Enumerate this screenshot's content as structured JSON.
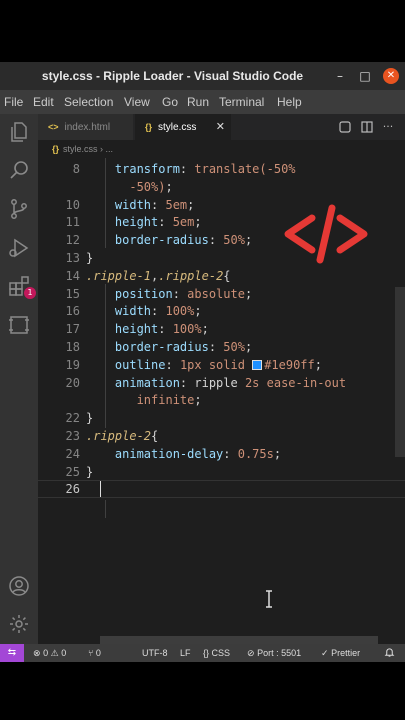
{
  "window": {
    "title": "style.css - Ripple Loader - Visual Studio Code",
    "min_glyph": "–",
    "max_glyph": "□",
    "close_glyph": "✕"
  },
  "menu": [
    "File",
    "Edit",
    "Selection",
    "View",
    "Go",
    "Run",
    "Terminal",
    "Help"
  ],
  "tabs": {
    "items": [
      {
        "icon": "<>",
        "label": "index.html"
      },
      {
        "icon": "{}",
        "label": "style.css",
        "close": "✕"
      }
    ],
    "more_glyph": "···"
  },
  "breadcrumb": {
    "icon": "{}",
    "file": "style.css",
    "sep": "› ..."
  },
  "activity": {
    "extensions_badge": "1"
  },
  "editor": {
    "lines": [
      {
        "n": "8",
        "parts": [
          [
            "p",
            "    transform"
          ],
          [
            "u",
            ": "
          ],
          [
            "v",
            "translate(-50%"
          ]
        ]
      },
      {
        "n": "",
        "parts": [
          [
            "v",
            "      -50%)"
          ],
          [
            "u",
            ";"
          ]
        ]
      },
      {
        "n": "10",
        "parts": [
          [
            "p",
            "    width"
          ],
          [
            "u",
            ": "
          ],
          [
            "v",
            "5em"
          ],
          [
            "u",
            ";"
          ]
        ]
      },
      {
        "n": "11",
        "parts": [
          [
            "p",
            "    height"
          ],
          [
            "u",
            ": "
          ],
          [
            "v",
            "5em"
          ],
          [
            "u",
            ";"
          ]
        ]
      },
      {
        "n": "12",
        "parts": [
          [
            "p",
            "    border-radius"
          ],
          [
            "u",
            ": "
          ],
          [
            "v",
            "50%"
          ],
          [
            "u",
            ";"
          ]
        ]
      },
      {
        "n": "13",
        "parts": [
          [
            "u",
            "}"
          ]
        ]
      },
      {
        "n": "14",
        "parts": [
          [
            "s",
            ".ripple-1"
          ],
          [
            "u",
            ","
          ],
          [
            "s",
            ".ripple-2"
          ],
          [
            "u",
            "{"
          ]
        ]
      },
      {
        "n": "15",
        "parts": [
          [
            "p",
            "    position"
          ],
          [
            "u",
            ": "
          ],
          [
            "v",
            "absolute"
          ],
          [
            "u",
            ";"
          ]
        ]
      },
      {
        "n": "16",
        "parts": [
          [
            "p",
            "    width"
          ],
          [
            "u",
            ": "
          ],
          [
            "v",
            "100%"
          ],
          [
            "u",
            ";"
          ]
        ]
      },
      {
        "n": "17",
        "parts": [
          [
            "p",
            "    height"
          ],
          [
            "u",
            ": "
          ],
          [
            "v",
            "100%"
          ],
          [
            "u",
            ";"
          ]
        ]
      },
      {
        "n": "18",
        "parts": [
          [
            "p",
            "    border-radius"
          ],
          [
            "u",
            ": "
          ],
          [
            "v",
            "50%"
          ],
          [
            "u",
            ";"
          ]
        ]
      },
      {
        "n": "19",
        "parts": [
          [
            "p",
            "    outline"
          ],
          [
            "u",
            ": "
          ],
          [
            "v",
            "1px solid "
          ],
          [
            "c",
            ""
          ],
          [
            "v",
            "#1e90ff"
          ],
          [
            "u",
            ";"
          ]
        ]
      },
      {
        "n": "20",
        "parts": [
          [
            "p",
            "    animation"
          ],
          [
            "u",
            ": "
          ],
          [
            "u",
            "ripple "
          ],
          [
            "v",
            "2s ease-in-out"
          ]
        ]
      },
      {
        "n": "",
        "parts": [
          [
            "v",
            "       infinite"
          ],
          [
            "u",
            ";"
          ]
        ]
      },
      {
        "n": "22",
        "parts": [
          [
            "u",
            "}"
          ]
        ]
      },
      {
        "n": "23",
        "parts": [
          [
            "s",
            ".ripple-2"
          ],
          [
            "u",
            "{"
          ]
        ]
      },
      {
        "n": "24",
        "parts": [
          [
            "p",
            "    animation-delay"
          ],
          [
            "u",
            ": "
          ],
          [
            "v",
            "0.75s"
          ],
          [
            "u",
            ";"
          ]
        ]
      },
      {
        "n": "25",
        "parts": [
          [
            "u",
            "}"
          ]
        ]
      },
      {
        "n": "26",
        "parts": []
      }
    ]
  },
  "status": {
    "remote_glyph": "⇆",
    "errors": "0",
    "warnings": "0",
    "ports": "0",
    "encoding": "UTF-8",
    "eol": "LF",
    "language": "CSS",
    "live_server": "Port : 5501",
    "formatter": "Prettier",
    "bell_glyph": "🔔"
  },
  "colors": {
    "swatch": "#1e90ff",
    "logo": "#e53935",
    "accent": "#e95420"
  }
}
